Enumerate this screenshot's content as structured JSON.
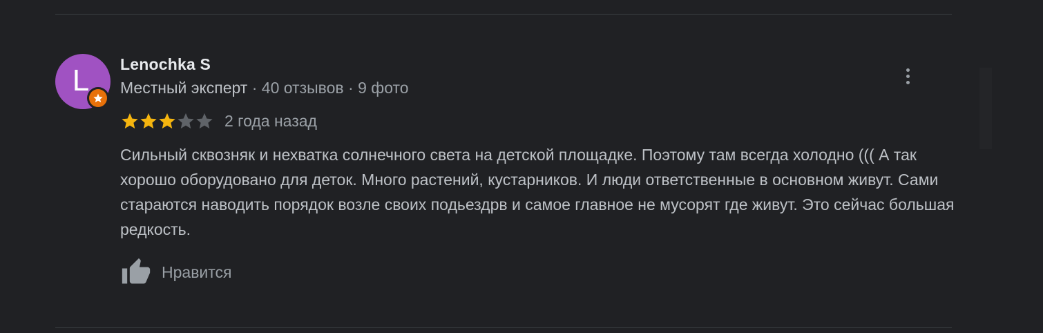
{
  "review": {
    "author": {
      "name": "Lenochka S",
      "initial": "L",
      "avatar_color": "#a052c2",
      "badge_color": "#e8710a",
      "badge_icon": "star-icon",
      "level": "Местный эксперт",
      "reviews_count": "40 отзывов",
      "photos_count": "9 фото",
      "separator": "·"
    },
    "rating": 3,
    "rating_max": 5,
    "star_color_filled": "#f5b50f",
    "star_color_empty": "#5f6368",
    "date": "2 года назад",
    "text": "Сильный сквозняк и нехватка солнечного света на детской площадке. Поэтому там всегда холодно ((( А так хорошо оборудовано для деток. Много растений, кустарников. И люди ответственные в основном живут. Сами стараются наводить порядок возле своих подьездрв и самое главное не мусорят где живут. Это сейчас большая редкость.",
    "like_label": "Нравится",
    "like_icon": "thumbs-up-icon",
    "more_icon": "more-vert-icon"
  }
}
